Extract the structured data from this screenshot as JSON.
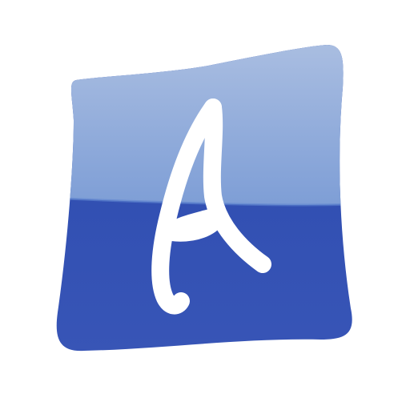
{
  "logo": {
    "icon": "letter-a-app-icon",
    "letter": "A",
    "colors": {
      "background": "#ffffff",
      "tile_top": "#b5c6e4",
      "tile_mid": "#7e9ed6",
      "tile_gloss_edge": "#5d84cf",
      "tile_lower": "#2a49ad",
      "tile_bottom": "#3a57b8",
      "letter": "#ffffff"
    }
  }
}
